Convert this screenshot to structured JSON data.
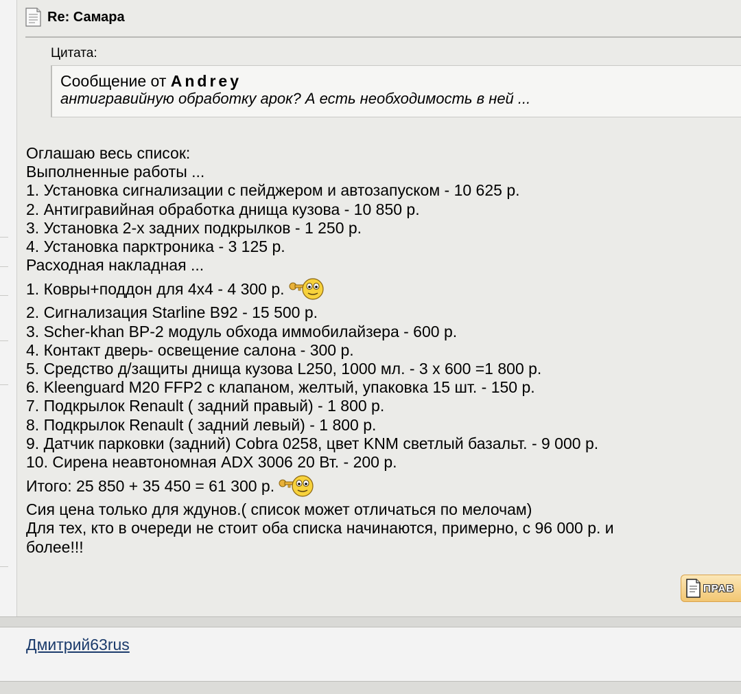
{
  "post": {
    "title": "Re: Самара",
    "quote": {
      "label": "Цитата:",
      "prefix": "Сообщение от ",
      "author": "Andrey",
      "text": "антигравийную обработку арок? А есть необходимость в ней ..."
    },
    "lines": [
      "Оглашаю весь список:",
      "Выполненные работы ...",
      "1. Установка сигнализации с пейджером и автозапуском - 10 625 р.",
      "2. Антигравийная обработка днища кузова - 10 850 р.",
      "3. Установка 2-х задних подкрылков - 1 250 р.",
      "4. Установка парктроника - 3 125 р.",
      "Расходная накладная ...",
      "1. Ковры+поддон для 4х4 - 4 300 р.",
      "2. Сигнализация Starline B92 - 15 500 р.",
      "3. Scher-khan BP-2 модуль обхода иммобилайзера - 600 р.",
      "4. Контакт дверь- освещение салона - 300 р.",
      "5. Средство д/защиты днища кузова L250, 1000 мл. - 3 х 600 =1 800 р.",
      "6. Kleenguard M20 FFP2 с клапаном, желтый, упаковка 15 шт. - 150 р.",
      "7. Подкрылок Renault ( задний правый) - 1 800 р.",
      "8. Подкрылок Renault ( задний левый) - 1 800 р.",
      "9. Датчик парковки (задний) Cobra 0258, цвет KNM светлый базальт. - 9 000 р.",
      "10. Сирена неавтономная ADX 3006 20 Вт. - 200 р.",
      "Итого: 25 850 + 35 450 = 61 300 р.",
      "Сия цена только для ждунов.( список может отличаться по мелочам)",
      "Для тех, кто в очереди не стоит оба списка начинаются, примерно, с 96 000 р. и более!!!"
    ],
    "edit_button": "ПРАВ",
    "icons": {
      "post": "document-icon",
      "smiley": "smiley-key-icon",
      "edit": "edit-icon"
    }
  },
  "next_post": {
    "author": "Дмитрий63rus"
  },
  "colors": {
    "background": "#ebebe8",
    "link": "#1a3a6b",
    "button": "#f2c672"
  }
}
